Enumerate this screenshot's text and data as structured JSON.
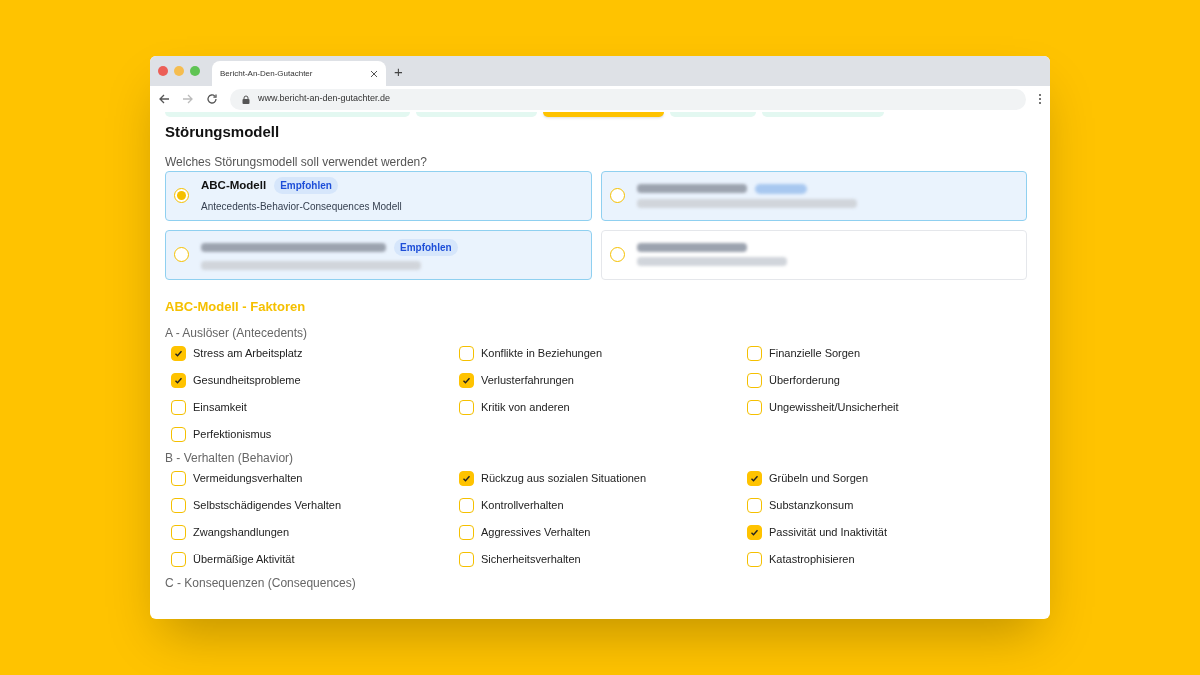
{
  "browser": {
    "tab_title": "Bericht-An-Den-Gutachter",
    "new_tab": "+",
    "url": "www.bericht-an-den-gutachter.de"
  },
  "steps": [
    {
      "selected": false
    },
    {
      "selected": false
    },
    {
      "selected": true
    },
    {
      "selected": false
    },
    {
      "selected": false
    }
  ],
  "title": "Störungsmodell",
  "question": "Welches Störungsmodell soll verwendet werden?",
  "options": [
    {
      "title": "ABC-Modell",
      "badge": "Empfohlen",
      "description": "Antecedents-Behavior-Consequences Modell",
      "selected": true,
      "highlighted": true,
      "redacted": false
    },
    {
      "selected": false,
      "highlighted": true,
      "redacted": true
    },
    {
      "badge": "Empfohlen",
      "selected": false,
      "highlighted": true,
      "redacted": true
    },
    {
      "selected": false,
      "highlighted": false,
      "redacted": true
    }
  ],
  "factors_title": "ABC-Modell - Faktoren",
  "groups": [
    {
      "title": "A - Auslöser (Antecedents)",
      "items": [
        {
          "label": "Stress am Arbeitsplatz",
          "checked": true
        },
        {
          "label": "Konflikte in Beziehungen",
          "checked": false
        },
        {
          "label": "Finanzielle Sorgen",
          "checked": false
        },
        {
          "label": "Gesundheitsprobleme",
          "checked": true
        },
        {
          "label": "Verlusterfahrungen",
          "checked": true
        },
        {
          "label": "Überforderung",
          "checked": false
        },
        {
          "label": "Einsamkeit",
          "checked": false
        },
        {
          "label": "Kritik von anderen",
          "checked": false
        },
        {
          "label": "Ungewissheit/Unsicherheit",
          "checked": false
        },
        {
          "label": "Perfektionismus",
          "checked": false
        }
      ]
    },
    {
      "title": "B - Verhalten (Behavior)",
      "items": [
        {
          "label": "Vermeidungsverhalten",
          "checked": false
        },
        {
          "label": "Rückzug aus sozialen Situationen",
          "checked": true
        },
        {
          "label": "Grübeln und Sorgen",
          "checked": true
        },
        {
          "label": "Selbstschädigendes Verhalten",
          "checked": false
        },
        {
          "label": "Kontrollverhalten",
          "checked": false
        },
        {
          "label": "Substanzkonsum",
          "checked": false
        },
        {
          "label": "Zwangshandlungen",
          "checked": false
        },
        {
          "label": "Aggressives Verhalten",
          "checked": false
        },
        {
          "label": "Passivität und Inaktivität",
          "checked": true
        },
        {
          "label": "Übermäßige Aktivität",
          "checked": false
        },
        {
          "label": "Sicherheitsverhalten",
          "checked": false
        },
        {
          "label": "Katastrophisieren",
          "checked": false
        }
      ]
    },
    {
      "title": "C - Konsequenzen (Consequences)"
    }
  ]
}
